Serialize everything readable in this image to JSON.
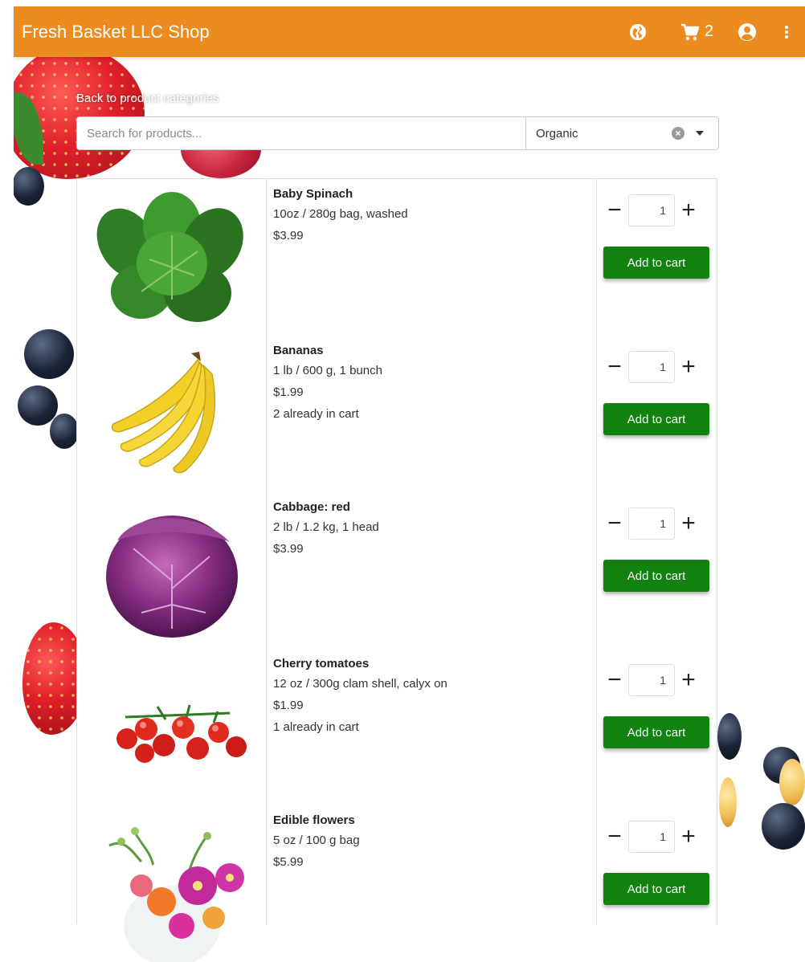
{
  "app": {
    "title": "Fresh Basket LLC Shop",
    "cart_count": "2",
    "accent_color": "#ec8b1e",
    "button_color": "#11820f"
  },
  "header_icons": [
    "globe-icon",
    "cart-icon",
    "account-icon",
    "more-vert-icon"
  ],
  "nav": {
    "back_label": "Back to product categories"
  },
  "search": {
    "placeholder": "Search for products...",
    "value": ""
  },
  "filter": {
    "value": "Organic"
  },
  "products": [
    {
      "name": "Baby Spinach",
      "size": "10oz / 280g bag, washed",
      "price": "$3.99",
      "note": "",
      "qty": "1",
      "add_label": "Add to cart"
    },
    {
      "name": "Bananas",
      "size": "1 lb / 600 g, 1 bunch",
      "price": "$1.99",
      "note": "2 already in cart",
      "qty": "1",
      "add_label": "Add to cart"
    },
    {
      "name": "Cabbage: red",
      "size": "2 lb / 1.2 kg, 1 head",
      "price": "$3.99",
      "note": "",
      "qty": "1",
      "add_label": "Add to cart"
    },
    {
      "name": "Cherry tomatoes",
      "size": "12 oz / 300g clam shell, calyx on",
      "price": "$1.99",
      "note": "1 already in cart",
      "qty": "1",
      "add_label": "Add to cart"
    },
    {
      "name": "Edible flowers",
      "size": "5 oz / 100 g bag",
      "price": "$5.99",
      "note": "",
      "qty": "1",
      "add_label": "Add to cart"
    }
  ]
}
